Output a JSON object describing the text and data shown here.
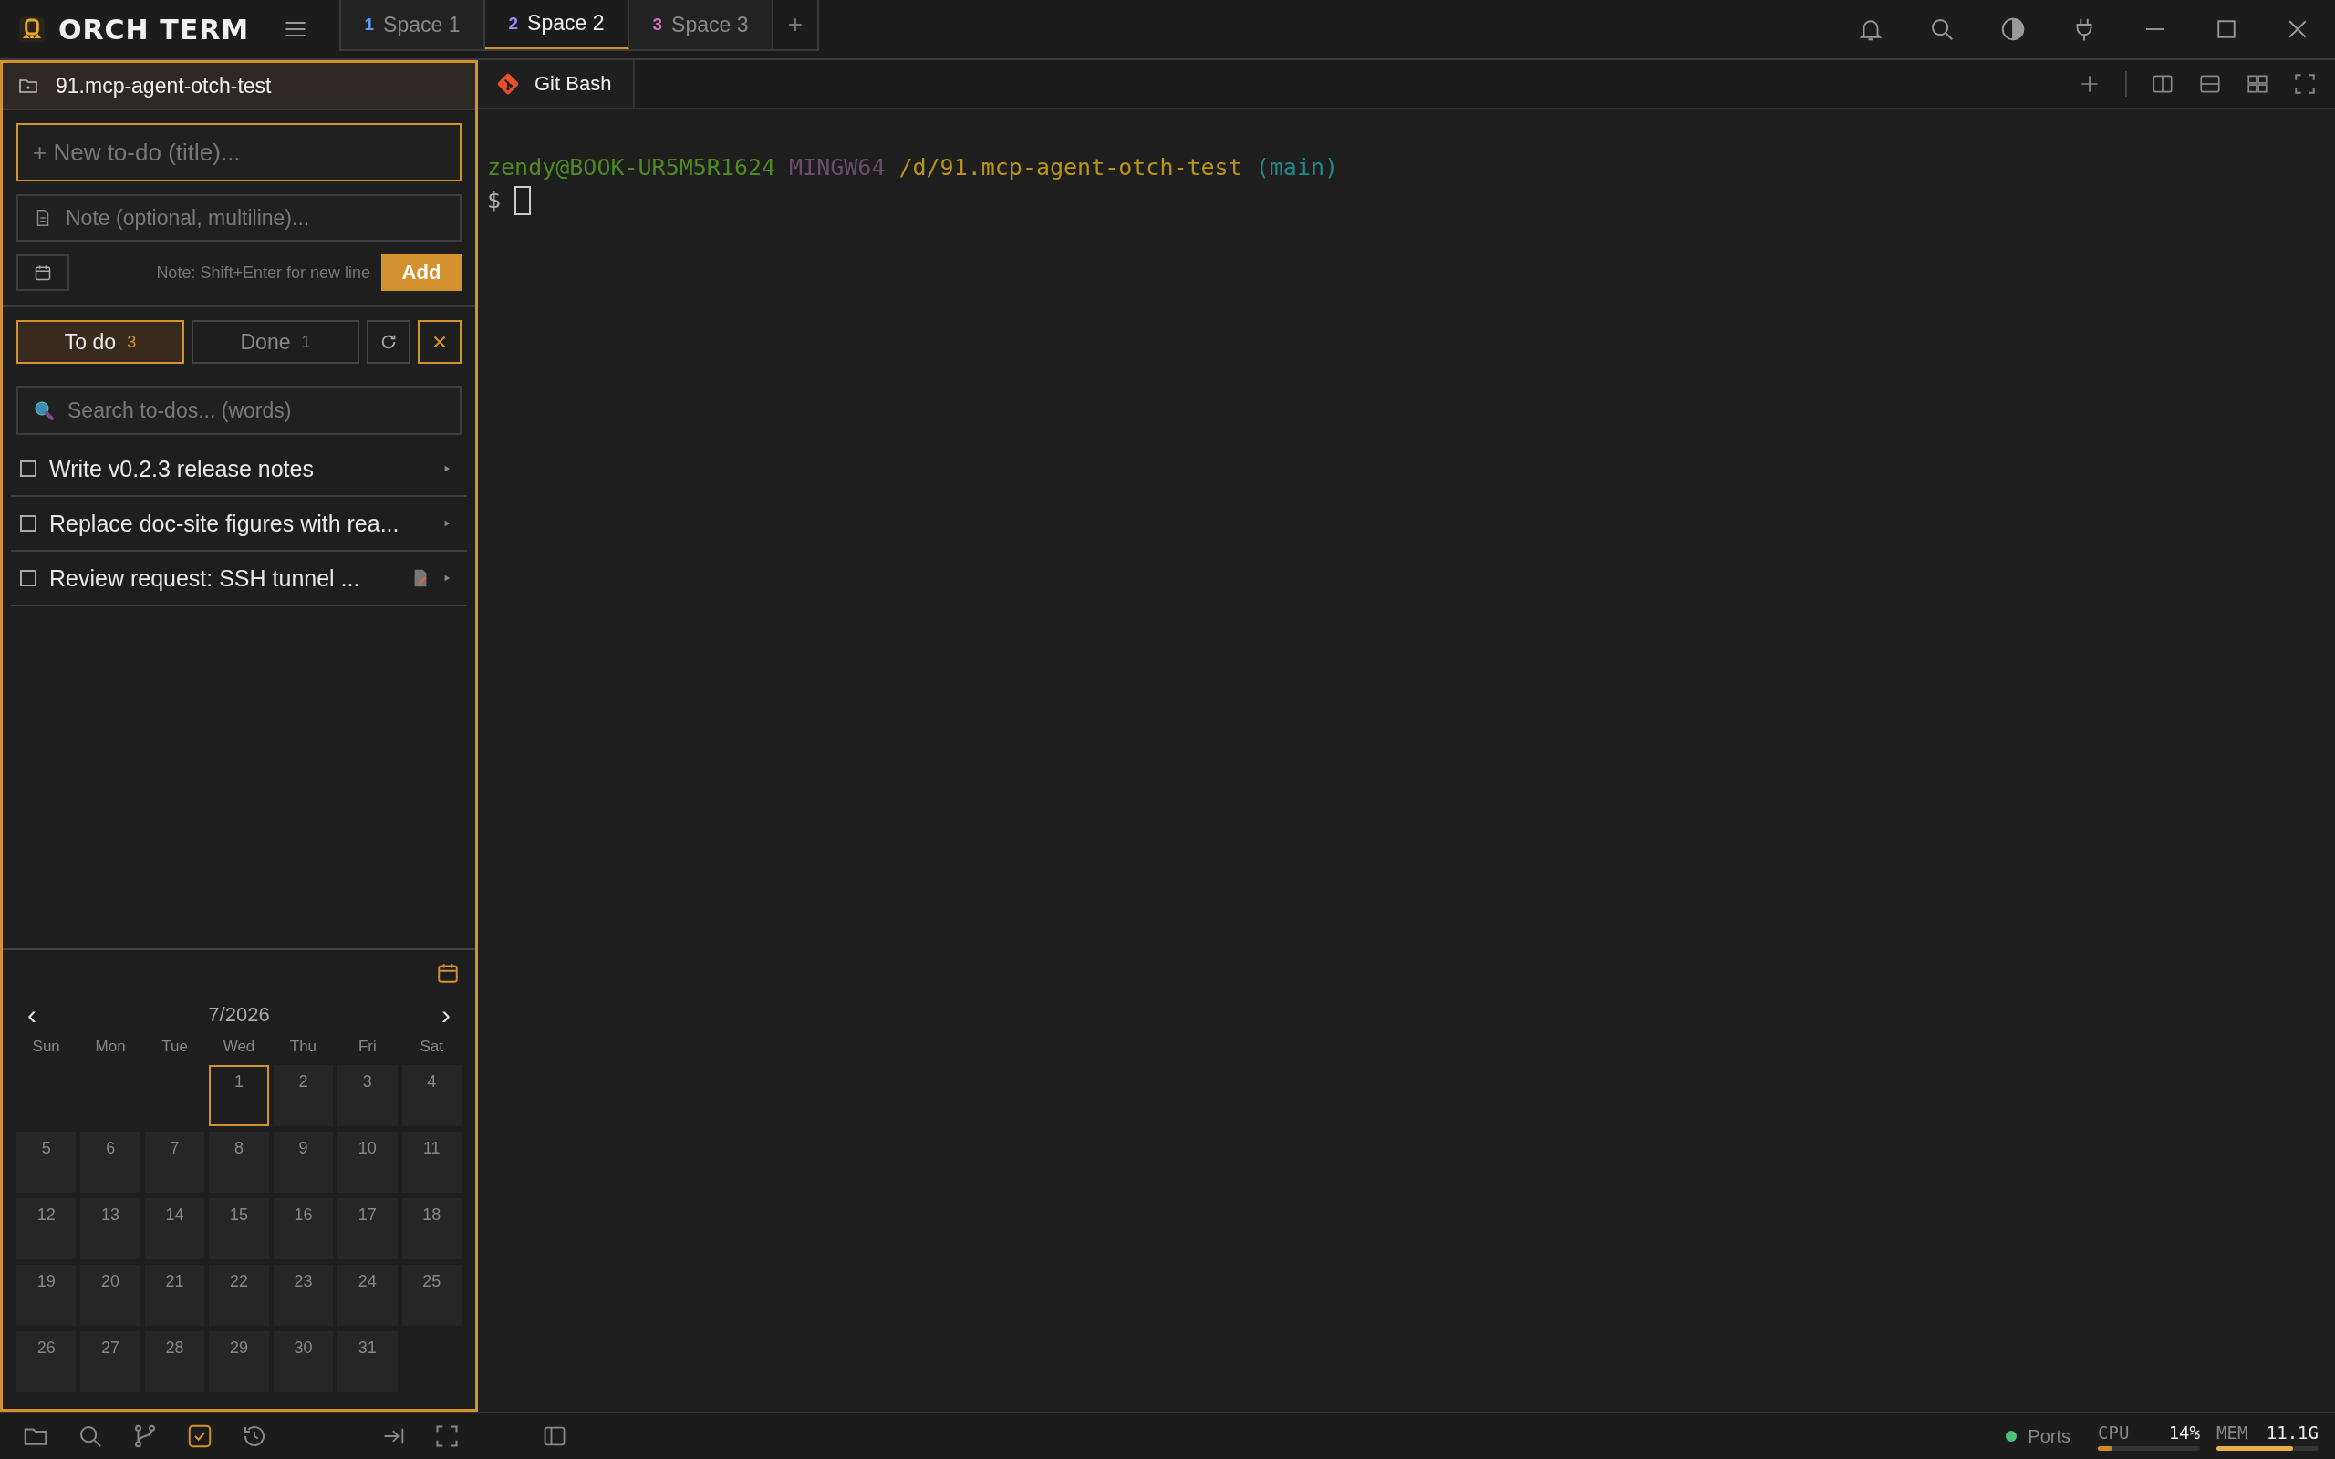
{
  "app": {
    "name": "ORCH TERM"
  },
  "spaces": [
    {
      "number": "1",
      "label": "Space 1",
      "color": "#5b9cf0",
      "selected": false
    },
    {
      "number": "2",
      "label": "Space 2",
      "color": "#a08cf0",
      "selected": true
    },
    {
      "number": "3",
      "label": "Space 3",
      "color": "#d36fc0",
      "selected": false
    }
  ],
  "new_space": "+",
  "todo_panel": {
    "project": "91.mcp-agent-otch-test",
    "title_field": {
      "placeholder": "+ New to-do (title)..."
    },
    "note_field": {
      "placeholder": "Note (optional, multiline)..."
    },
    "hint": "Note: Shift+Enter for new line",
    "add_button": "Add",
    "filters": [
      {
        "label": "To do",
        "count": "3",
        "selected": true
      },
      {
        "label": "Done",
        "count": "1",
        "selected": false
      }
    ],
    "search": {
      "placeholder": "Search to-dos... (words)"
    },
    "items": [
      {
        "title": "Write v0.2.3 release notes",
        "checked": false,
        "note": false
      },
      {
        "title": "Replace doc-site figures with rea...",
        "checked": false,
        "note": false
      },
      {
        "title": "Review request: SSH tunnel ...",
        "checked": false,
        "note": true
      }
    ],
    "calendar": {
      "prev": "‹",
      "month": "7/2026",
      "next": "›",
      "weekdays": [
        "Sun",
        "Mon",
        "Tue",
        "Wed",
        "Thu",
        "Fri",
        "Sat"
      ],
      "weeks": [
        [
          {
            "kind": "blank"
          },
          {
            "kind": "blank"
          },
          {
            "kind": "blank"
          },
          {
            "day": "1",
            "selected": true
          },
          {
            "day": "2",
            "selected": false
          },
          {
            "day": "3",
            "selected": false
          },
          {
            "day": "4",
            "selected": false
          }
        ],
        [
          {
            "day": "5",
            "selected": false
          },
          {
            "day": "6",
            "selected": false
          },
          {
            "day": "7",
            "selected": false
          },
          {
            "day": "8",
            "selected": false
          },
          {
            "day": "9",
            "selected": false
          },
          {
            "day": "10",
            "selected": false
          },
          {
            "day": "11",
            "selected": false
          }
        ],
        [
          {
            "day": "12",
            "selected": false
          },
          {
            "day": "13",
            "selected": false
          },
          {
            "day": "14",
            "selected": false
          },
          {
            "day": "15",
            "selected": false
          },
          {
            "day": "16",
            "selected": false
          },
          {
            "day": "17",
            "selected": false
          },
          {
            "day": "18",
            "selected": false
          }
        ],
        [
          {
            "day": "19",
            "selected": false
          },
          {
            "day": "20",
            "selected": false
          },
          {
            "day": "21",
            "selected": false
          },
          {
            "day": "22",
            "selected": false
          },
          {
            "day": "23",
            "selected": false
          },
          {
            "day": "24",
            "selected": false
          },
          {
            "day": "25",
            "selected": false
          }
        ],
        [
          {
            "day": "26",
            "selected": false
          },
          {
            "day": "27",
            "selected": false
          },
          {
            "day": "28",
            "selected": false
          },
          {
            "day": "29",
            "selected": false
          },
          {
            "day": "30",
            "selected": false
          },
          {
            "day": "31",
            "selected": false
          },
          {
            "kind": "blank"
          }
        ]
      ]
    }
  },
  "terminal": {
    "tab": "Git Bash",
    "lines": [
      [
        {
          "text": "zendy@BOOK-UR5M5R1624",
          "color": "#4e8a1e"
        },
        {
          "text": "MINGW64",
          "color": "#6b4d6b"
        },
        {
          "text": "/d/91.mcp-agent-otch-test",
          "color": "#b89417"
        },
        {
          "text": "(main)",
          "color": "#1f8a8a"
        }
      ],
      [
        {
          "text": "$",
          "color": "#b0b0b0"
        }
      ]
    ]
  },
  "bottom_tools": [
    {
      "kind": "folder",
      "selected": false
    },
    {
      "kind": "search",
      "selected": false
    },
    {
      "kind": "branch",
      "selected": false
    },
    {
      "kind": "todo",
      "selected": true
    },
    {
      "kind": "history",
      "selected": false
    }
  ],
  "status": {
    "ports": "Ports",
    "meters": [
      {
        "label": "CPU",
        "value": "14%",
        "level": 0.14,
        "color": "#d08a2a"
      },
      {
        "label": "MEM",
        "value": "11.1G",
        "level": 0.75,
        "color": "#e8b04a"
      }
    ]
  }
}
